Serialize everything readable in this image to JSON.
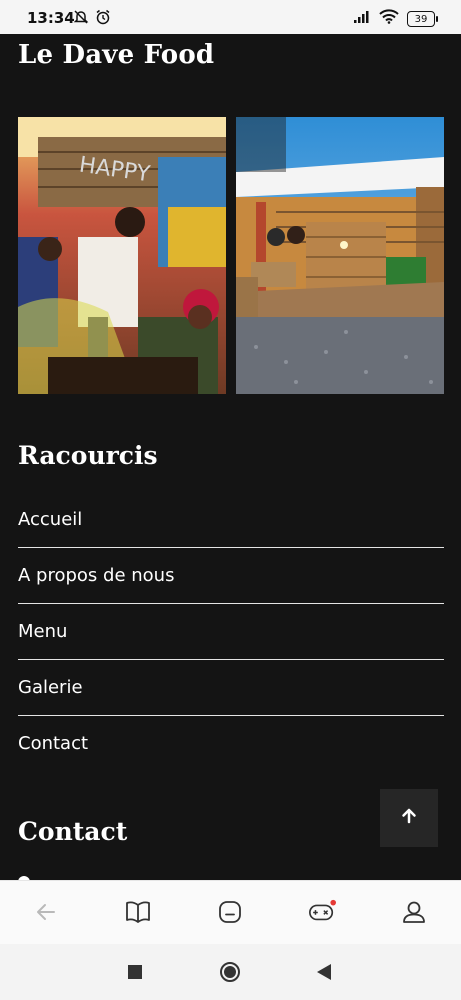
{
  "status_bar": {
    "time": "13:34",
    "battery": "39"
  },
  "site": {
    "title": "Le Dave Food"
  },
  "gallery": {
    "images": [
      "party-photo",
      "terrace-photo"
    ]
  },
  "shortcuts": {
    "heading": "Racourcis",
    "items": [
      "Accueil",
      "A propos de nous",
      "Menu",
      "Galerie",
      "Contact"
    ]
  },
  "contact": {
    "heading": "Contact"
  },
  "colors": {
    "background": "#141414",
    "text": "#ffffff",
    "accent_dot": "#e53935"
  },
  "browser_bar": {
    "icons": [
      "back-arrow-icon",
      "book-icon",
      "home-icon",
      "gamepad-icon",
      "profile-icon"
    ]
  },
  "android_nav": {
    "icons": [
      "recents-icon",
      "home-icon",
      "back-icon"
    ]
  }
}
